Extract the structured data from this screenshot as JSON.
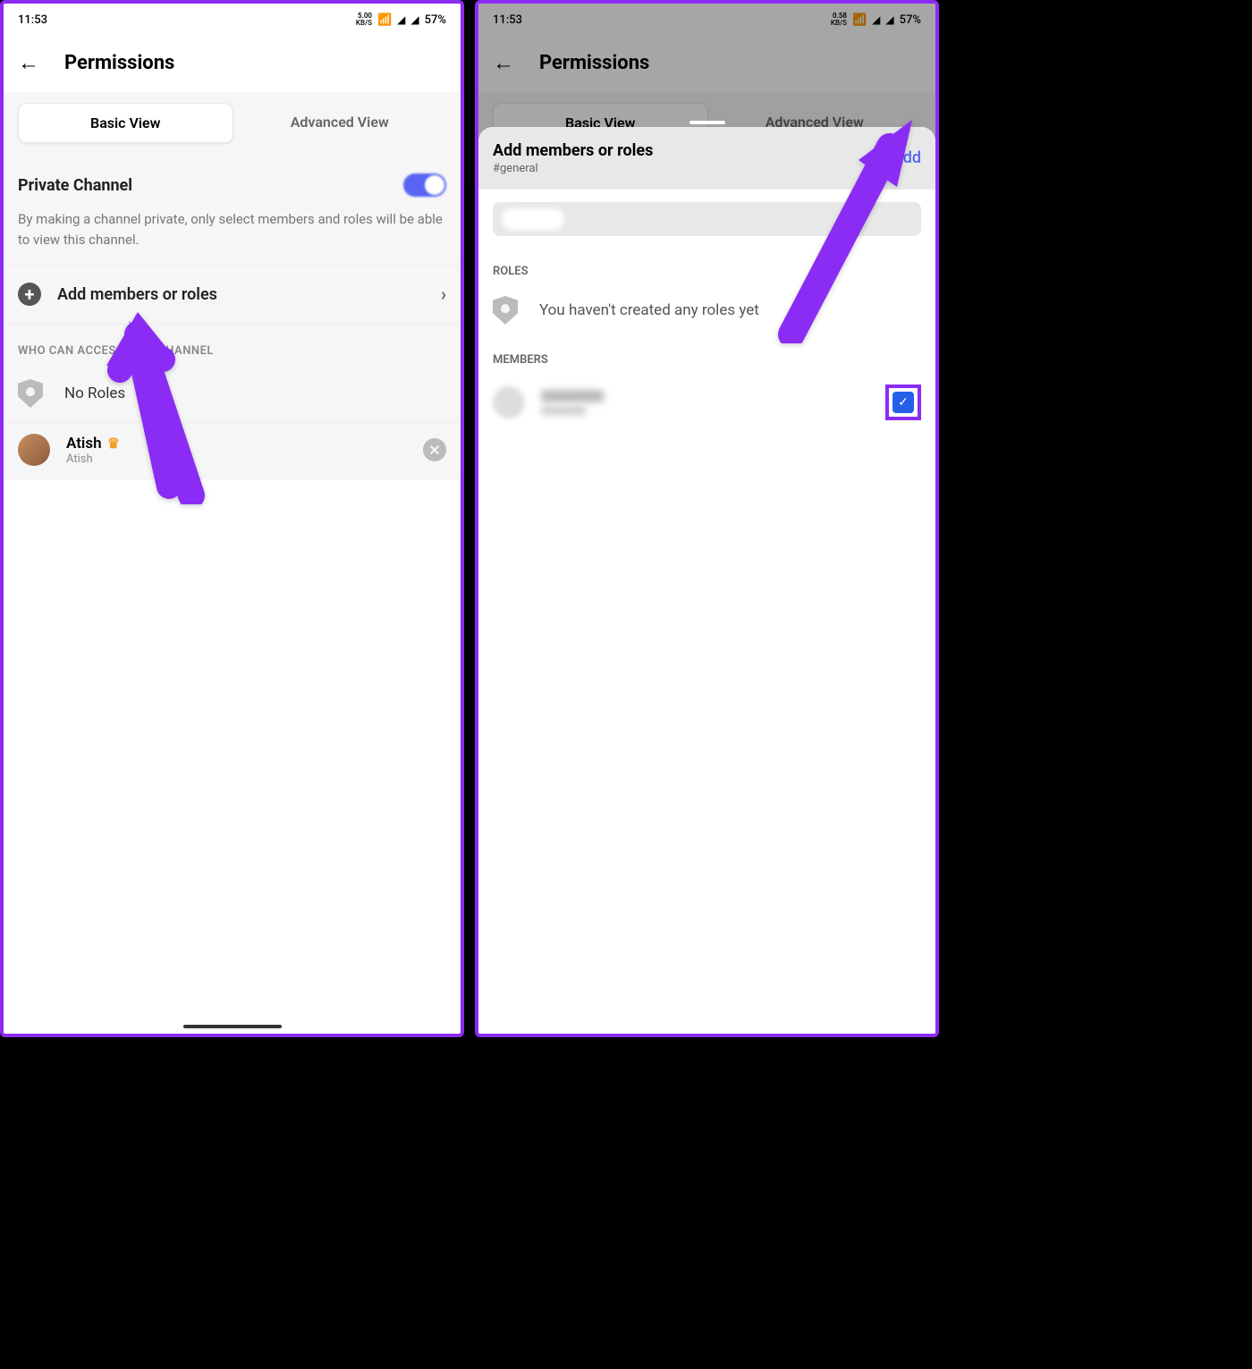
{
  "left": {
    "status": {
      "time": "11:53",
      "kbs_top": "5.00",
      "kbs_bot": "KB/S",
      "battery": "57%"
    },
    "header": {
      "title": "Permissions"
    },
    "tabs": {
      "basic": "Basic View",
      "advanced": "Advanced View"
    },
    "private": {
      "title": "Private Channel",
      "desc": "By making a channel private, only select members and roles will be able to view this channel."
    },
    "add": {
      "label": "Add members or roles"
    },
    "access_label": "WHO CAN ACCESS THIS CHANNEL",
    "no_roles": "No Roles",
    "member": {
      "name": "Atish",
      "sub": "Atish"
    }
  },
  "right": {
    "status": {
      "time": "11:53",
      "kbs_top": "0.58",
      "kbs_bot": "KB/S",
      "battery": "57%"
    },
    "header": {
      "title": "Permissions"
    },
    "tabs": {
      "basic": "Basic View",
      "advanced": "Advanced View"
    },
    "sheet": {
      "title": "Add members or roles",
      "sub": "#general",
      "add": "Add",
      "roles_label": "ROLES",
      "roles_empty": "You haven't created any roles yet",
      "members_label": "MEMBERS"
    }
  }
}
